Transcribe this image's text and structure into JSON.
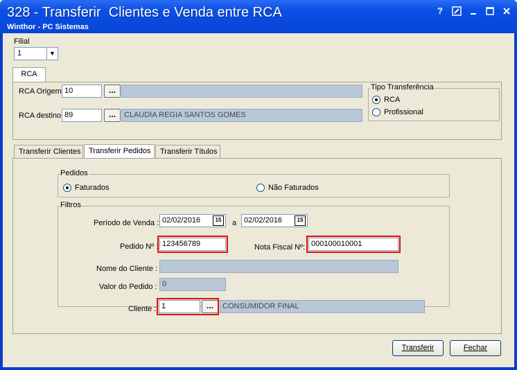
{
  "window": {
    "title": "328 - Transferir  Clientes e Venda entre RCA",
    "subtitle": "Winthor - PC Sistemas"
  },
  "filial": {
    "label": "Filial",
    "value": "1"
  },
  "rca_tab": {
    "label": "RCA",
    "origem_label": "RCA Origem",
    "origem_value": "10",
    "origem_name": "",
    "destino_label": "RCA destino",
    "destino_value": "89",
    "destino_name": "CLAUDIA REGIA SANTOS GOMES",
    "browse": "..."
  },
  "tipo": {
    "title": "Tipo Transferência",
    "options": [
      "RCA",
      "Profissional"
    ],
    "selected": "RCA"
  },
  "tabs": [
    "Transferir Clientes",
    "Transferir Pedidos",
    "Transferir Títulos"
  ],
  "active_tab": "Transferir Pedidos",
  "pedidos": {
    "title": "Pedidos",
    "options": [
      "Faturados",
      "Não Faturados"
    ],
    "selected": "Faturados"
  },
  "filtros": {
    "title": "Filtros",
    "periodo_label": "Período de Venda :",
    "periodo_de": "02/02/2016",
    "periodo_sep": "a",
    "periodo_ate": "02/02/2016",
    "cal_icon": "15",
    "pedido_label": "Pedido Nº :",
    "pedido_value": "123456789",
    "nota_label": "Nota Fiscal Nº:",
    "nota_value": "000100010001",
    "nome_label": "Nome do Cliente :",
    "nome_value": "",
    "valor_label": "Valor do Pedido :",
    "valor_value": "0",
    "cliente_label": "Cliente :",
    "cliente_value": "1",
    "cliente_name": "CONSUMIDOR FINAL",
    "browse": "..."
  },
  "buttons": {
    "transferir": "Transferir",
    "fechar": "Fechar"
  },
  "colors": {
    "titlebar": "#0a50e6",
    "highlight": "#e01010",
    "readonly": "#b8c8d9"
  }
}
